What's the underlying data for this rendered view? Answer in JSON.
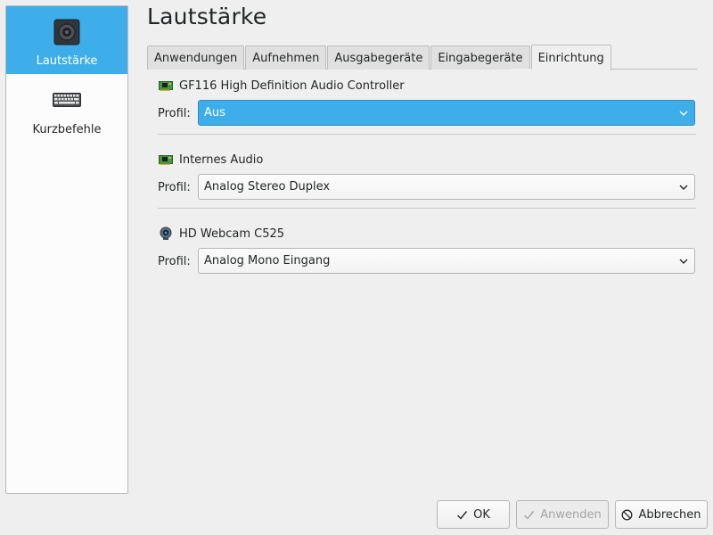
{
  "sidebar": {
    "items": [
      {
        "label": "Lautstärke",
        "icon": "speaker-icon",
        "selected": true
      },
      {
        "label": "Kurzbefehle",
        "icon": "keyboard-icon",
        "selected": false
      }
    ]
  },
  "page": {
    "title": "Lautstärke"
  },
  "tabs": [
    {
      "label": "Anwendungen"
    },
    {
      "label": "Aufnehmen"
    },
    {
      "label": "Ausgabegeräte"
    },
    {
      "label": "Eingabegeräte"
    },
    {
      "label": "Einrichtung",
      "active": true
    }
  ],
  "devices": [
    {
      "name": "GF116 High Definition Audio Controller",
      "icon": "sound-card-icon",
      "profile_label": "Profil:",
      "profile": "Aus",
      "focused": true
    },
    {
      "name": "Internes Audio",
      "icon": "sound-card-icon",
      "profile_label": "Profil:",
      "profile": "Analog Stereo Duplex",
      "focused": false
    },
    {
      "name": "HD Webcam C525",
      "icon": "webcam-icon",
      "profile_label": "Profil:",
      "profile": "Analog Mono Eingang",
      "focused": false
    }
  ],
  "buttons": {
    "ok": "OK",
    "apply": "Anwenden",
    "cancel": "Abbrechen"
  },
  "colors": {
    "accent": "#3daee9",
    "background": "#efefef",
    "text": "#232627"
  }
}
